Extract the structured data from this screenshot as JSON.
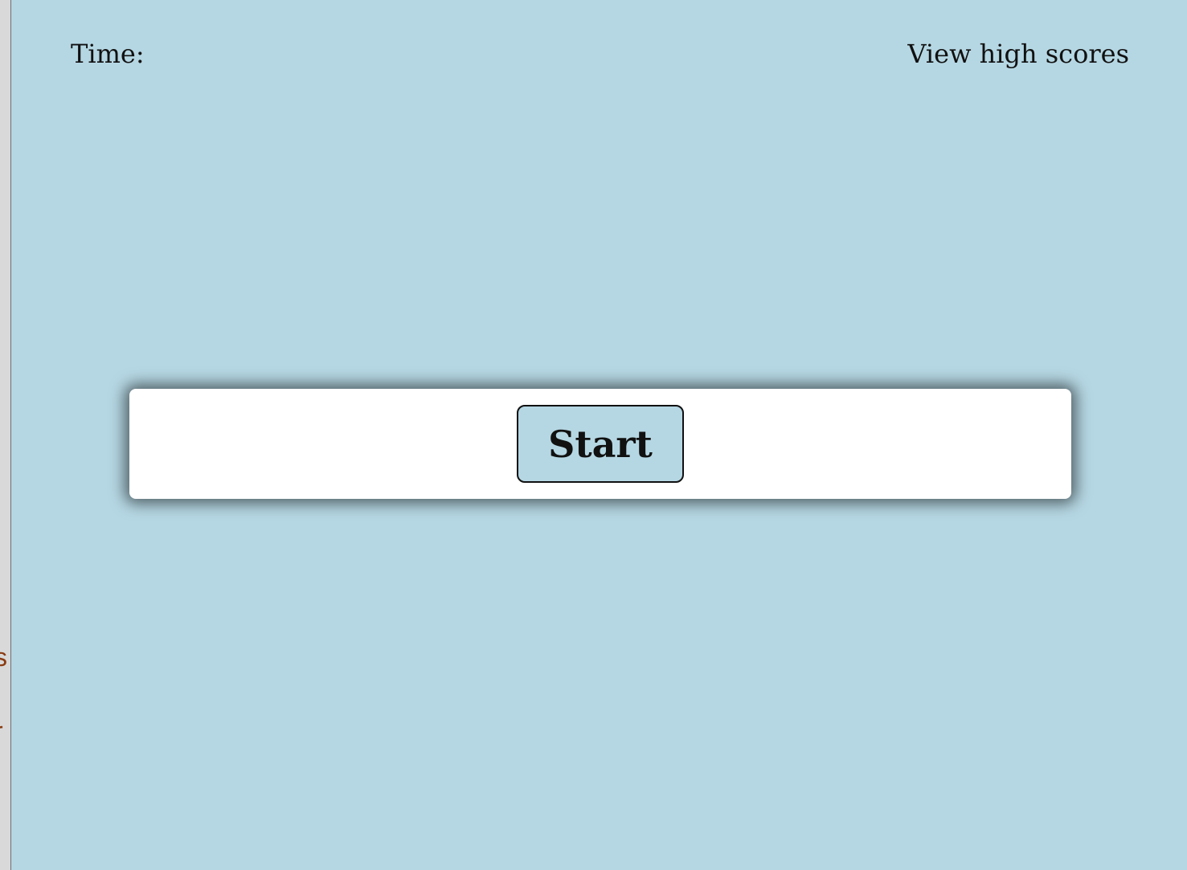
{
  "header": {
    "time_label": "Time:",
    "time_value": "",
    "high_scores_label": "View high scores"
  },
  "main": {
    "start_label": "Start"
  },
  "left_edge": {
    "clipped_chars": [
      "s",
      "r"
    ]
  },
  "colors": {
    "background": "#b5d7e3",
    "panel": "#ffffff",
    "button_fill": "#b5d7e3",
    "text": "#111111",
    "edge_text": "#8a3b12"
  }
}
